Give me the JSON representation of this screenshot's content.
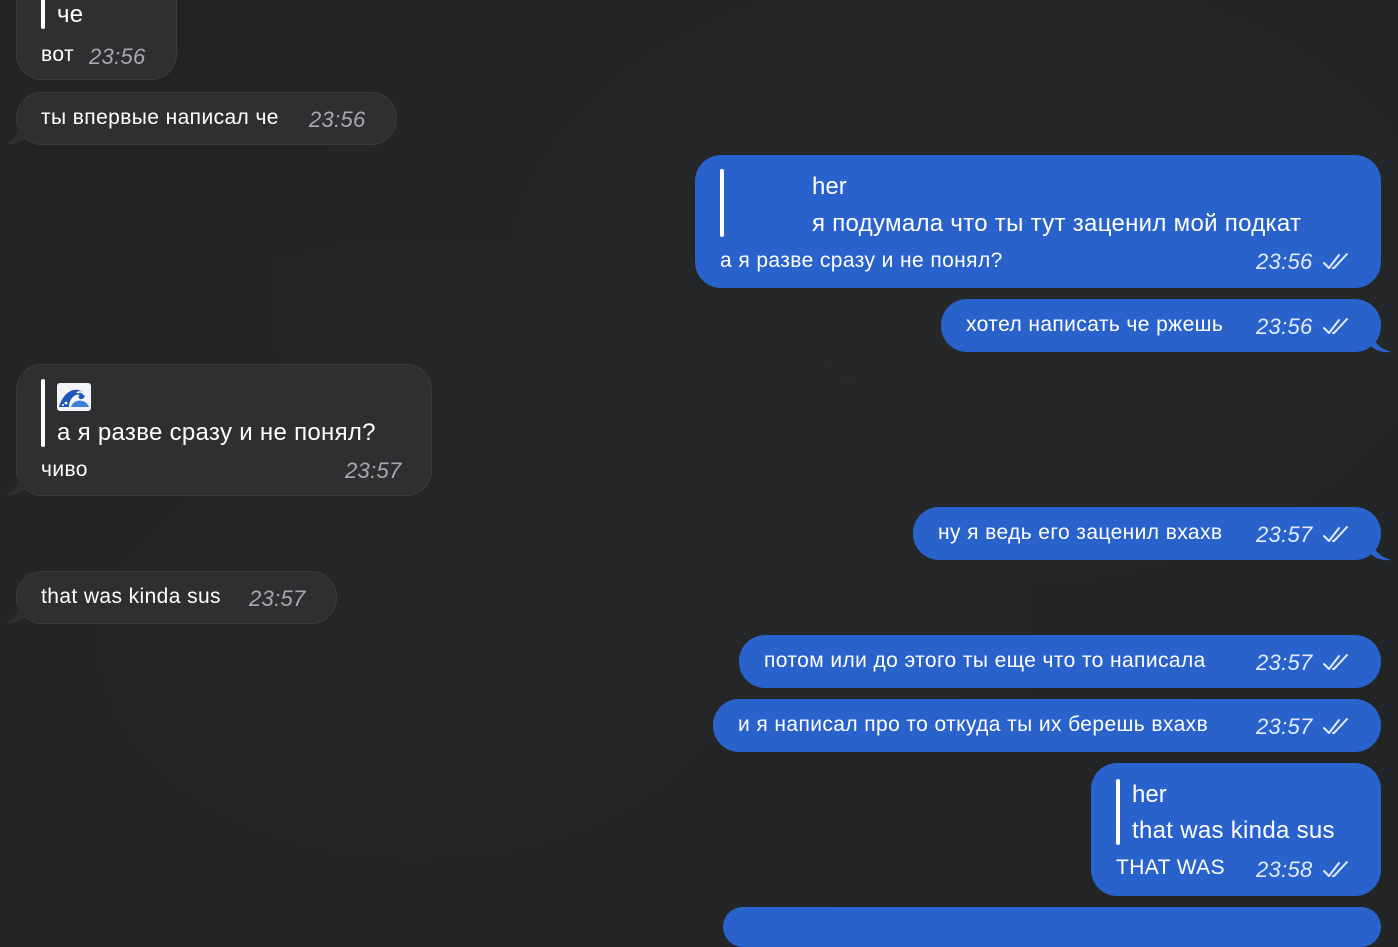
{
  "messages": [
    {
      "id": "m1",
      "side": "in",
      "reply": {
        "text": "че"
      },
      "text": "вот",
      "time": "23:56"
    },
    {
      "id": "m2",
      "side": "in",
      "text": "ты впервые написал че",
      "time": "23:56"
    },
    {
      "id": "m3",
      "side": "out",
      "reply": {
        "name": "her",
        "text": "я подумала что ты тут заценил мой подкат"
      },
      "text": "а я разве сразу и не понял?",
      "time": "23:56"
    },
    {
      "id": "m4",
      "side": "out",
      "text": "хотел написать че ржешь",
      "time": "23:56"
    },
    {
      "id": "m5",
      "side": "in",
      "reply": {
        "emoji": "wave",
        "text": "а я разве сразу и не понял?"
      },
      "text": "чиво",
      "time": "23:57"
    },
    {
      "id": "m6",
      "side": "out",
      "text": "ну я ведь его заценил вхахв",
      "time": "23:57"
    },
    {
      "id": "m7",
      "side": "in",
      "text": "that was kinda sus",
      "time": "23:57"
    },
    {
      "id": "m8",
      "side": "out",
      "text": "потом или до этого ты еще что то написала",
      "time": "23:57"
    },
    {
      "id": "m9",
      "side": "out",
      "text": "и я написал про то откуда ты их берешь вхахв",
      "time": "23:57"
    },
    {
      "id": "m10",
      "side": "out",
      "reply": {
        "name": "her",
        "text": "that was kinda sus"
      },
      "text": "THAT WAS",
      "time": "23:58"
    }
  ],
  "icons": {
    "read_receipt": "double-check-icon",
    "reply_emoji": "water-wave-icon"
  },
  "colors": {
    "background": "#222426",
    "incoming_bubble": "#2e2f31",
    "outgoing_bubble": "#2a62cc",
    "incoming_time": "#a8a9ad"
  }
}
